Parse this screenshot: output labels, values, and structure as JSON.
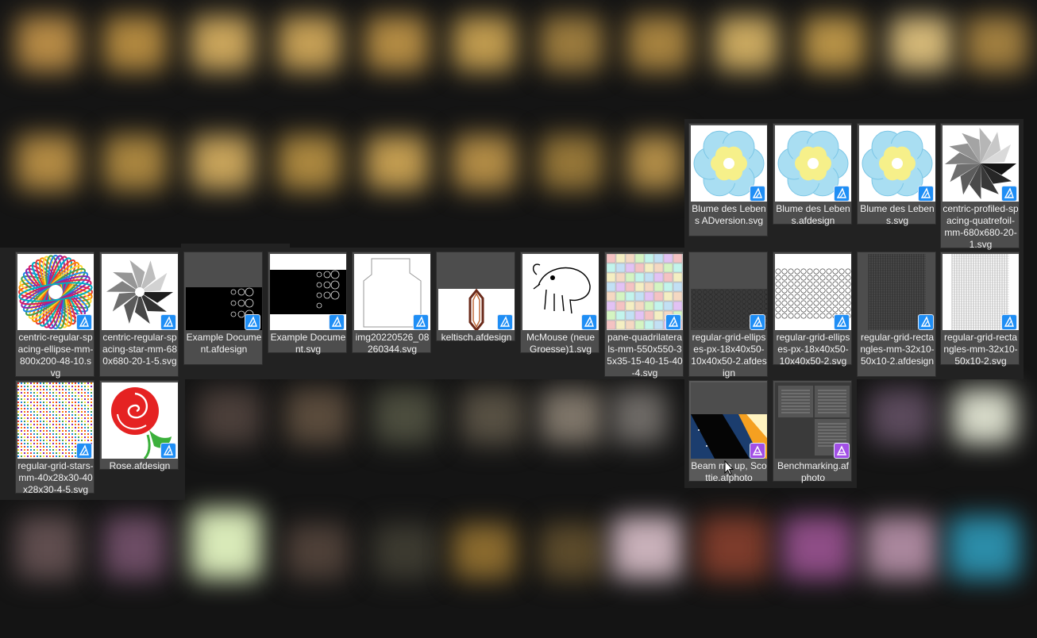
{
  "files": [
    {
      "name": "Blume des Lebens ADversion.svg",
      "app": "designer",
      "thumb": "flower",
      "selected": false
    },
    {
      "name": "Blume des Lebens.afdesign",
      "app": "designer",
      "thumb": "flower",
      "selected": false
    },
    {
      "name": "Blume des Lebens.svg",
      "app": "designer",
      "thumb": "flower",
      "selected": false
    },
    {
      "name": "centric-profiled-spacing-quatrefoil-mm-680x680-20-1.svg",
      "app": "designer",
      "thumb": "spiral-gray",
      "selected": false
    },
    {
      "name": "centric-regular-spacing-ellipse-mm-800x200-48-10.svg",
      "app": "designer",
      "thumb": "rainbow-petals",
      "selected": false
    },
    {
      "name": "centric-regular-spacing-star-mm-680x680-20-1-5.svg",
      "app": "designer",
      "thumb": "spiral-star",
      "selected": false
    },
    {
      "name": "Example Document.afdesign",
      "app": "designer",
      "thumb": "black-bubbles-band",
      "selected": false
    },
    {
      "name": "Example Document.svg",
      "app": "designer",
      "thumb": "black-bubbles",
      "selected": false
    },
    {
      "name": "img20220526_08260344.svg",
      "app": "designer",
      "thumb": "outline-shape",
      "selected": false
    },
    {
      "name": "keltisch.afdesign",
      "app": "designer",
      "thumb": "celtic-knot",
      "selected": false
    },
    {
      "name": "McMouse (neue Groesse)1.svg",
      "app": "designer",
      "thumb": "mouse-sketch",
      "selected": false
    },
    {
      "name": "pane-quadrilaterals-mm-550x550-35x35-15-40-15-40-4.svg",
      "app": "designer",
      "thumb": "pastel-mosaic",
      "selected": false
    },
    {
      "name": "regular-grid-ellipses-px-18x40x50-10x40x50-2.afdesign",
      "app": "designer",
      "thumb": "dark-grid",
      "selected": false
    },
    {
      "name": "regular-grid-ellipses-px-18x40x50-10x40x50-2.svg",
      "app": "designer",
      "thumb": "light-circles",
      "selected": false
    },
    {
      "name": "regular-grid-rectangles-mm-32x10-50x10-2.afdesign",
      "app": "designer",
      "thumb": "dark-rect-grid",
      "selected": false
    },
    {
      "name": "regular-grid-rectangles-mm-32x10-50x10-2.svg",
      "app": "designer",
      "thumb": "light-rect-grid",
      "selected": false
    },
    {
      "name": "regular-grid-stars-mm-40x28x30-40x28x30-4-5.svg",
      "app": "designer",
      "thumb": "noise-stars",
      "selected": false
    },
    {
      "name": "Rose.afdesign",
      "app": "designer",
      "thumb": "rose",
      "selected": false
    },
    {
      "name": "Beam me up, Scottie.afphoto",
      "app": "photo",
      "thumb": "space-beam",
      "selected": true
    },
    {
      "name": "Benchmarking.afphoto",
      "app": "photo",
      "thumb": "document-screens",
      "selected": false
    }
  ],
  "colors": {
    "designer_badge": "#1f8ef5",
    "photo_badge": "#a24fe6",
    "tile_background": "#4d4d4d",
    "panel_background": "#222222"
  }
}
